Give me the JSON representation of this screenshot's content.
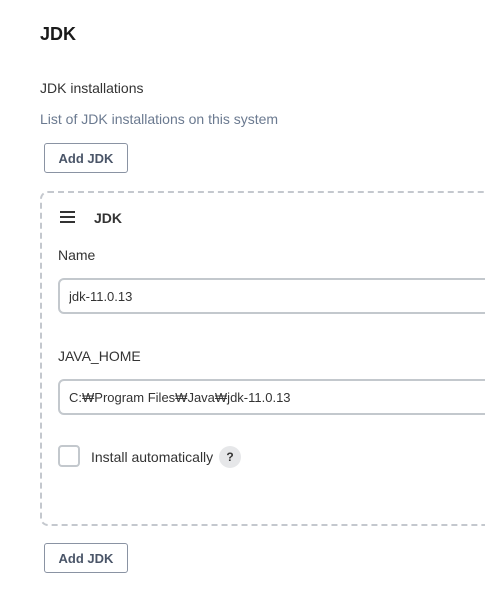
{
  "section": {
    "title": "JDK"
  },
  "jdk_installations": {
    "label": "JDK installations",
    "description": "List of JDK installations on this system",
    "add_button_label": "Add JDK",
    "items": [
      {
        "header": "JDK",
        "name_label": "Name",
        "name_value": "jdk-11.0.13",
        "java_home_label": "JAVA_HOME",
        "java_home_value": "C:₩Program Files₩Java₩jdk-11.0.13",
        "install_auto_label": "Install automatically",
        "install_auto_checked": false,
        "help_glyph": "?"
      }
    ],
    "add_button_label_bottom": "Add JDK"
  },
  "icons": {
    "drag_handle": "hamburger-icon",
    "help": "help-icon"
  }
}
